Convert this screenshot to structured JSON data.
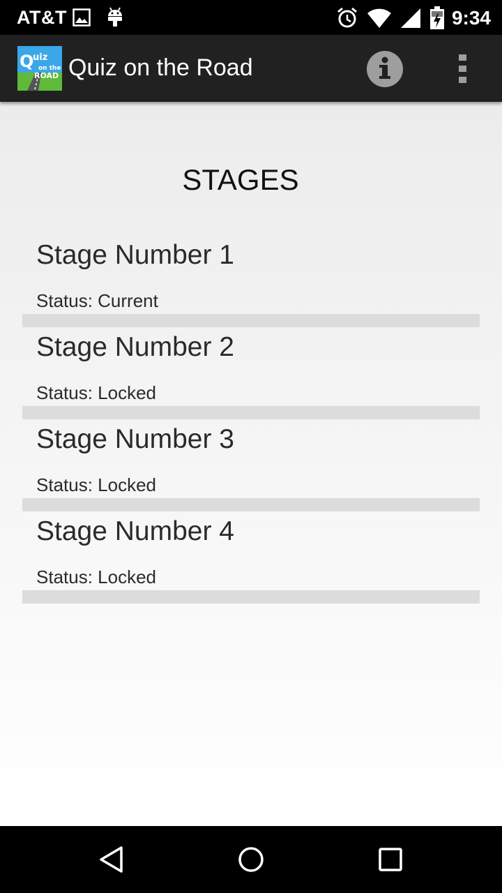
{
  "status_bar": {
    "carrier": "AT&T",
    "time": "9:34",
    "left_icons": [
      "image-icon",
      "android-icon"
    ],
    "right_icons": [
      "alarm-icon",
      "wifi-icon",
      "signal-icon",
      "battery-charging-icon"
    ]
  },
  "action_bar": {
    "title": "Quiz on the Road",
    "logo": {
      "line1": "Quiz",
      "line2": "on the",
      "line3": "ROAD"
    },
    "info_icon": "info-icon",
    "overflow_icon": "more-vert-icon"
  },
  "page": {
    "heading": "STAGES"
  },
  "stages": [
    {
      "name": "Stage Number 1",
      "status": "Status: Current"
    },
    {
      "name": "Stage Number 2",
      "status": "Status: Locked"
    },
    {
      "name": "Stage Number 3",
      "status": "Status: Locked"
    },
    {
      "name": "Stage Number 4",
      "status": "Status: Locked"
    }
  ],
  "nav_bar": {
    "back_icon": "back-icon",
    "home_icon": "home-icon",
    "recents_icon": "recents-icon"
  },
  "colors": {
    "action_bar": "#212121",
    "divider": "#dcdcdc",
    "text": "#2a2a2a"
  }
}
